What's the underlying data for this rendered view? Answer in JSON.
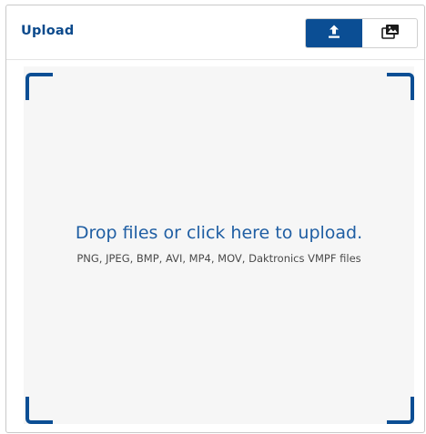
{
  "panel": {
    "title": "Upload"
  },
  "toggle": {
    "upload_icon": "upload-icon",
    "media_library_icon": "media-library-icon"
  },
  "dropzone": {
    "main_text": "Drop files or click here to upload.",
    "sub_text": "PNG, JPEG, BMP, AVI, MP4, MOV, Daktronics VMPF files"
  },
  "colors": {
    "accent": "#0b4e94",
    "title": "#0c4a8c",
    "dropzone_background": "#f6f6f6",
    "main_text": "#1f5ea3"
  }
}
